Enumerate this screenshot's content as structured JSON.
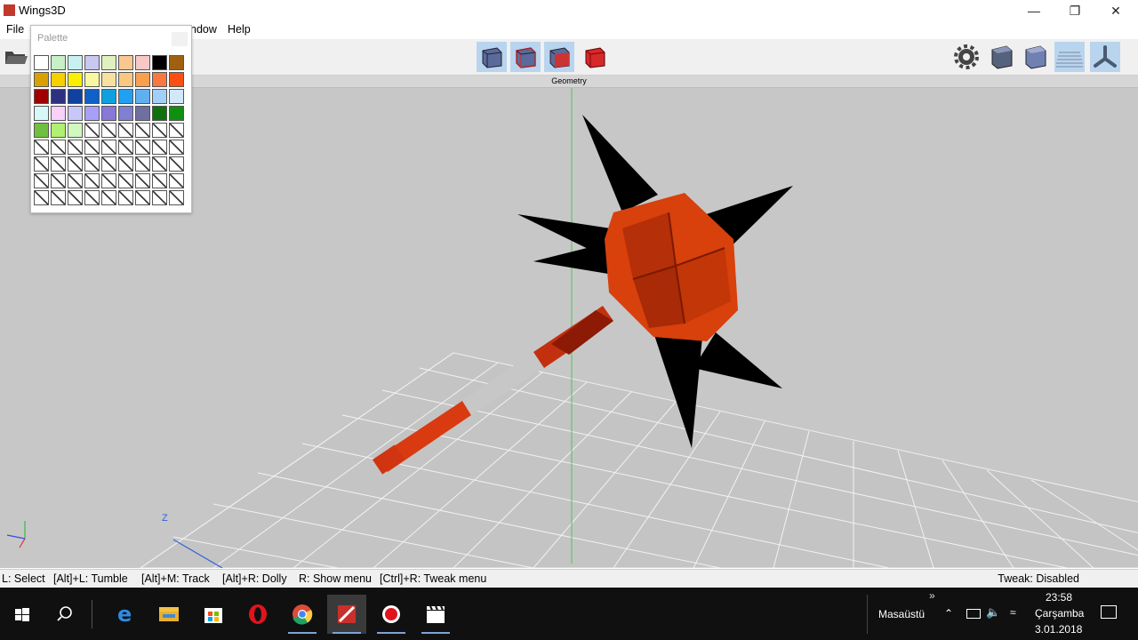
{
  "window": {
    "title": "Wings3D"
  },
  "menu": {
    "file": "File",
    "window": "ndow",
    "help": "Help"
  },
  "toolbar": {
    "select_modes": [
      {
        "name": "vertex-mode-button",
        "active": true
      },
      {
        "name": "edge-mode-button",
        "active": true
      },
      {
        "name": "face-mode-button",
        "active": true
      },
      {
        "name": "body-mode-button",
        "active": false
      }
    ]
  },
  "geometry": {
    "label": "Geometry"
  },
  "palette": {
    "title": "Palette",
    "colors": [
      "#ffffff",
      "#c8f0c8",
      "#c8f0f0",
      "#c8c8f0",
      "#e0f0c0",
      "#f8c890",
      "#f8c8c8",
      "#000000",
      "#a06010",
      "#d8a000",
      "#f8d000",
      "#f8f000",
      "#f8f8a0",
      "#f8e0a0",
      "#f8c880",
      "#f8a050",
      "#f87840",
      "#f85010",
      "#a00000",
      "#303080",
      "#1040a0",
      "#1060c8",
      "#10a0e0",
      "#20a0f0",
      "#60b0f0",
      "#a0d0f8",
      "#d0e8f8",
      "#d8f8f8",
      "#f8d0f8",
      "#c8c8f8",
      "#a8a0f8",
      "#8878d8",
      "#8080d0",
      "#7070a0",
      "#107010",
      "#109010",
      "#70c040",
      "#b0f070",
      "#d0f8c0"
    ],
    "empty_count": 42
  },
  "viewport": {
    "axis_label": "Z"
  },
  "status": {
    "hints": [
      "L: Select",
      "[Alt]+L: Tumble",
      "[Alt]+M: Track",
      "[Alt]+R: Dolly",
      "R: Show menu",
      "[Ctrl]+R: Tweak menu"
    ],
    "tweak": "Tweak: Disabled"
  },
  "taskbar": {
    "desktop_label": "Masaüstü",
    "time": "23:58",
    "day": "Çarşamba",
    "date": "3.01.2018"
  }
}
